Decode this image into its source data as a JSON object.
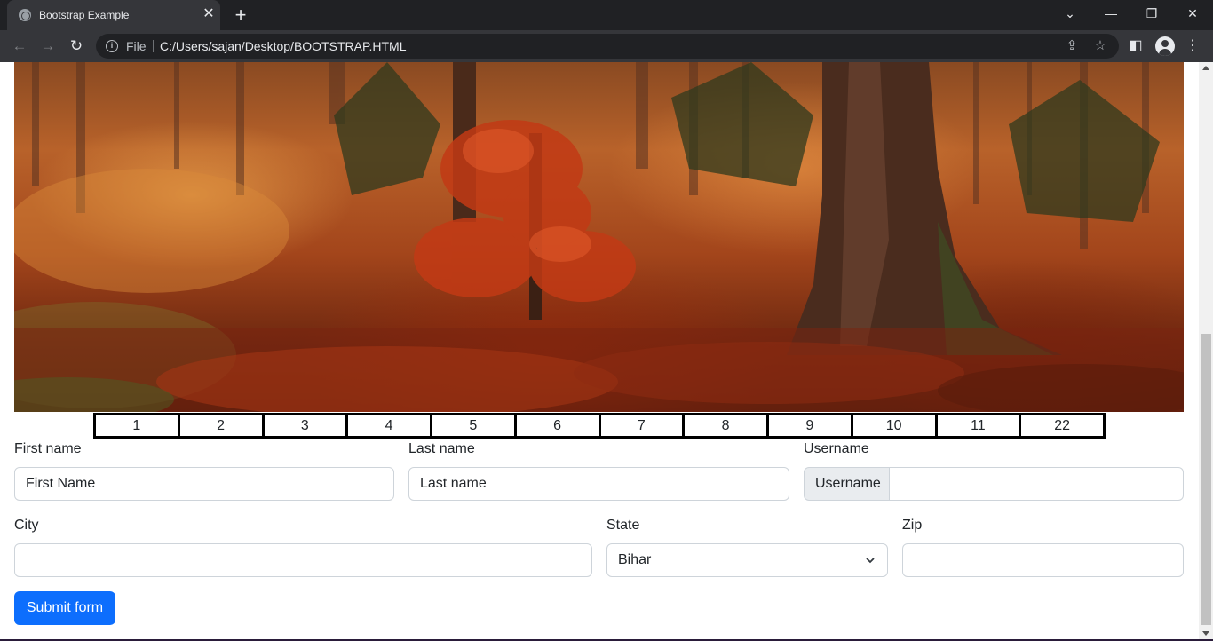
{
  "browser": {
    "tab_title": "Bootstrap Example",
    "url_scheme_label": "File",
    "url": "C:/Users/sajan/Desktop/BOOTSTRAP.HTML"
  },
  "pagination": {
    "cells": [
      "1",
      "2",
      "3",
      "4",
      "5",
      "6",
      "7",
      "8",
      "9",
      "10",
      "11",
      "22"
    ]
  },
  "form": {
    "first_name_label": "First name",
    "first_name_value": "First Name",
    "last_name_label": "Last name",
    "last_name_value": "Last name",
    "username_label": "Username",
    "username_addon": "Username",
    "username_value": "",
    "city_label": "City",
    "city_value": "",
    "state_label": "State",
    "state_selected": "Bihar",
    "zip_label": "Zip",
    "zip_value": "",
    "submit_label": "Submit form"
  },
  "colors": {
    "primary_button": "#0d6efd",
    "chrome_dark": "#202124",
    "chrome_toolbar": "#35363a"
  }
}
